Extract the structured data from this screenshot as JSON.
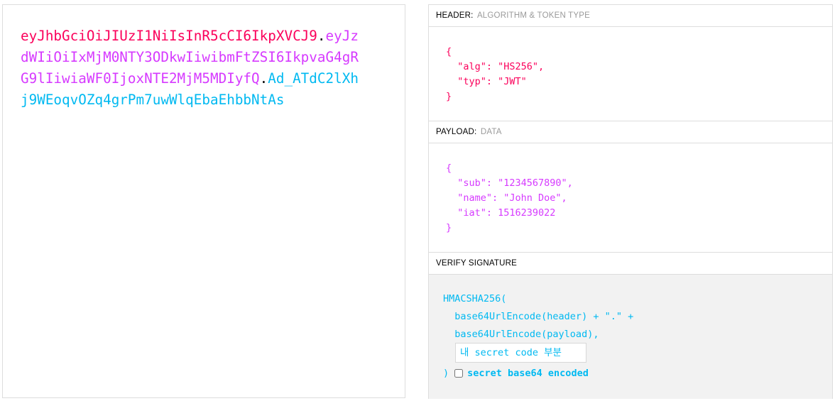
{
  "encoded": {
    "header_part": "eyJhbGciOiJIUzI1NiIsInR5cCI6IkpXVCJ9",
    "payload_part": "eyJzdWIiOiIxMjM0NTY3ODkwIiwibmFtZSI6IkpvaG4gRG9lIiwiaWF0IjoxNTE2MjM5MDIyfQ",
    "signature_part": "Ad_ATdC2lXhj9WEoqvOZq4grPm7uwWlqEbaEhbbNtAs",
    "separator": "."
  },
  "header_section": {
    "title": "HEADER:",
    "subtitle": "ALGORITHM & TOKEN TYPE",
    "json_lines": [
      "{",
      "  \"alg\": \"HS256\",",
      "  \"typ\": \"JWT\"",
      "}"
    ]
  },
  "payload_section": {
    "title": "PAYLOAD:",
    "subtitle": "DATA",
    "json_lines": [
      "{",
      "  \"sub\": \"1234567890\",",
      "  \"name\": \"John Doe\",",
      "  \"iat\": 1516239022",
      "}"
    ]
  },
  "verify_section": {
    "title": "VERIFY SIGNATURE",
    "line1": "HMACSHA256(",
    "line2": "  base64UrlEncode(header) + \".\" +",
    "line3": "  base64UrlEncode(payload),",
    "secret_placeholder": "내 secret code 부분",
    "secret_value": "",
    "close_paren": ")",
    "base64_label": "secret base64 encoded",
    "base64_checked": false
  },
  "colors": {
    "header": "#fb015b",
    "payload": "#d63aff",
    "signature": "#00b9f1"
  }
}
